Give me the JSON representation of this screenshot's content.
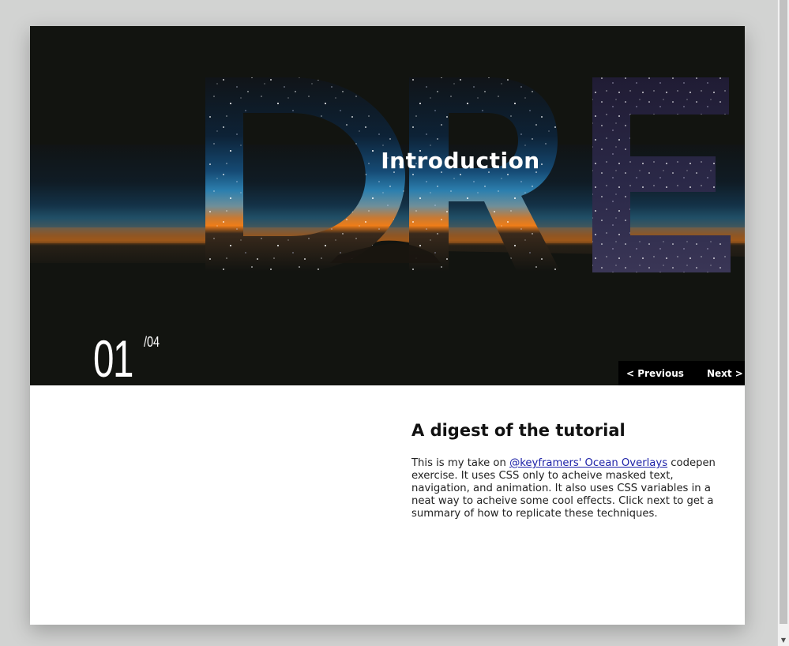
{
  "hero": {
    "masked_text": "DRE",
    "title": "Introduction",
    "slide_number": "01",
    "slide_total": "/04"
  },
  "nav": {
    "previous_label": "< Previous",
    "next_label": "Next >"
  },
  "content": {
    "heading": "A digest of the tutorial",
    "body_before": "This is my take on ",
    "link_text": "@keyframers' Ocean Overlays",
    "body_after": " codepen exercise. It uses CSS only to acheive masked text, navigation, and animation. It also uses CSS variables in a neat way to acheive some cool effects. Click next to get a summary of how to replicate these techniques."
  },
  "colors": {
    "page_background": "#d2d3d2",
    "hero_background": "#121410",
    "sky_orange": "#e8731c",
    "sky_blue": "#1f5f8a",
    "link": "#1d22a8"
  },
  "icons": {
    "scroll_down": "triangle-down"
  }
}
